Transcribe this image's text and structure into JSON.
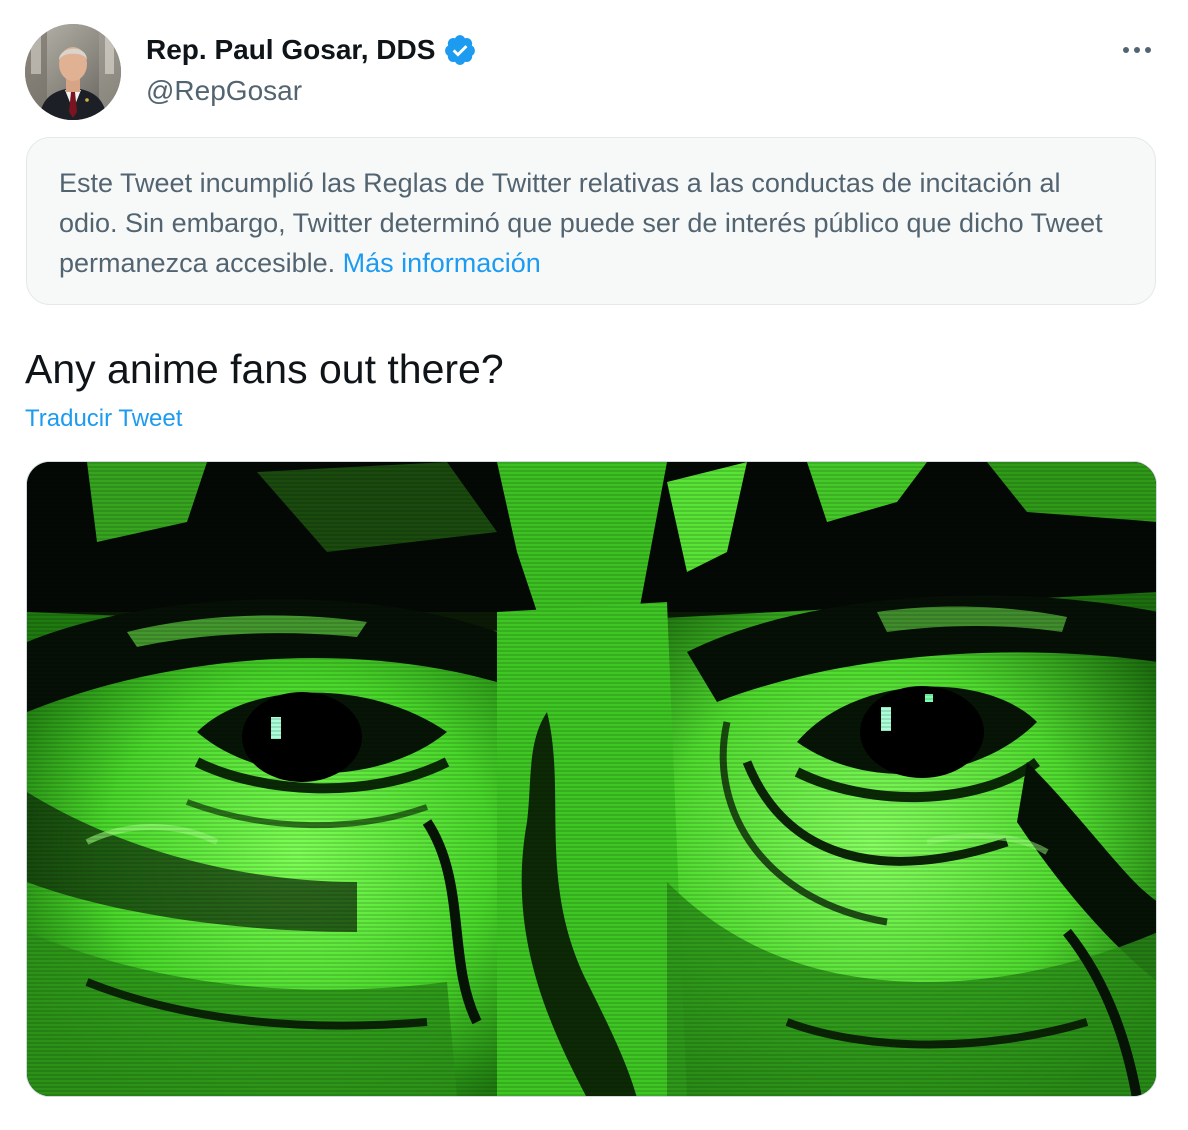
{
  "author": {
    "display_name": "Rep. Paul Gosar, DDS",
    "handle": "@RepGosar",
    "verified": true,
    "avatar_icon": "portrait-avatar",
    "verified_icon": "verified-badge-icon"
  },
  "menu": {
    "icon": "more-horizontal-icon"
  },
  "notice": {
    "text": "Este Tweet incumplió las Reglas de Twitter relativas a las conductas de incitación al odio. Sin embargo, Twitter determinó que puede ser de interés público que dicho Tweet permanezca accesible.",
    "link_label": "Más información"
  },
  "tweet": {
    "text": "Any anime fans out there?",
    "translate_label": "Traducir Tweet"
  },
  "media": {
    "type": "image",
    "description_icon": "green-eyes-image"
  },
  "colors": {
    "accent": "#1d9bf0",
    "primary_text": "#0f1419",
    "secondary_text": "#536471",
    "notice_bg": "#f7f9f9",
    "media_green": "#5ef23a"
  }
}
